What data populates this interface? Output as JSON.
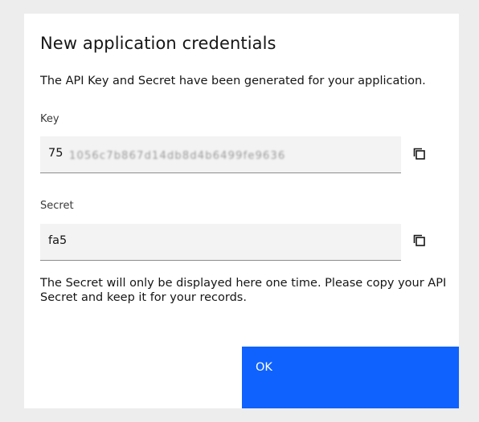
{
  "dialog": {
    "title": "New application credentials",
    "description": "The API Key and Secret have been generated for your application.",
    "note": "The Secret will only be displayed here one time. Please copy your API Secret and keep it for your records.",
    "ok_label": "OK"
  },
  "fields": {
    "key": {
      "label": "Key",
      "value_visible": "75",
      "value_obscured": "1056c7b867d14db8d4b6499fe9636"
    },
    "secret": {
      "label": "Secret",
      "value_visible": "fa5"
    }
  },
  "icons": {
    "copy": "copy-icon"
  },
  "colors": {
    "primary_button": "#0f62fe",
    "field_background": "#f3f3f3",
    "backdrop": "#ededed"
  }
}
